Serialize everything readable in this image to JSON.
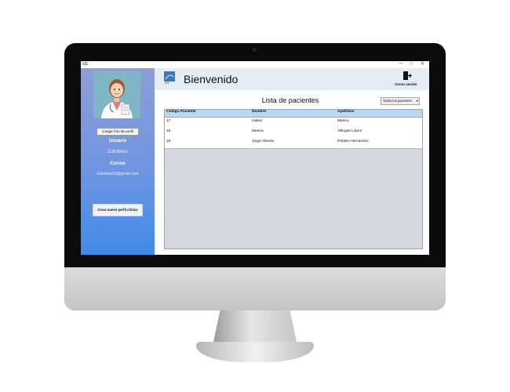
{
  "app": {
    "icon_label": "idc"
  },
  "window_controls": {
    "minimize": "—",
    "maximize": "□",
    "close": "✕"
  },
  "sidebar": {
    "upload_photo_label": "Cargar foto de perfil",
    "user_heading": "Usuario",
    "user_value": "Edrobles",
    "email_heading": "Correo",
    "email_value": "Edrobles20@gmail.com",
    "create_profile_label": "Crear nuevo perfil clínico"
  },
  "header": {
    "logo_text": "IDC",
    "welcome": "Bienvenido",
    "logout_label": "Cerrar sesión"
  },
  "main": {
    "list_title": "Lista de pacientes",
    "filter_value": "Todos los pacientes"
  },
  "table": {
    "columns": [
      "Código Paciente",
      "Nombre",
      "Apellidos"
    ],
    "rows": [
      [
        "17",
        "Isabel",
        "Merino"
      ],
      [
        "18",
        "Merina",
        "Villegas López"
      ],
      [
        "19",
        "Jorge Alberto",
        "Robles Hernández"
      ]
    ]
  },
  "colors": {
    "sidebar_top": "#8d9ed6",
    "sidebar_bottom": "#3f8be8",
    "header_row": "#b9d7f3",
    "table_empty": "#d5d9df"
  }
}
